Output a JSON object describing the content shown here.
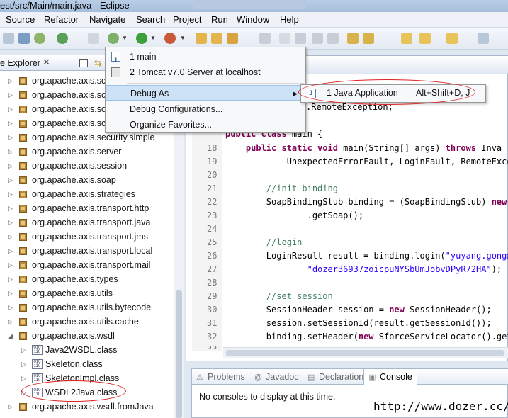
{
  "window": {
    "title": "est/src/Main/main.java - Eclipse"
  },
  "menubar": {
    "items": [
      "Source",
      "Refactor",
      "Navigate",
      "Search",
      "Project",
      "Run",
      "Window",
      "Help"
    ]
  },
  "package_explorer": {
    "title": "e Explorer",
    "close_glyph": "✕",
    "packages": [
      "org.apache.axis.sc",
      "org.apache.axis.sc",
      "org.apache.axis.sc",
      "org.apache.axis.sc",
      "org.apache.axis.security.simple",
      "org.apache.axis.server",
      "org.apache.axis.session",
      "org.apache.axis.soap",
      "org.apache.axis.strategies",
      "org.apache.axis.transport.http",
      "org.apache.axis.transport.java",
      "org.apache.axis.transport.jms",
      "org.apache.axis.transport.local",
      "org.apache.axis.transport.mail",
      "org.apache.axis.types",
      "org.apache.axis.utils",
      "org.apache.axis.utils.bytecode",
      "org.apache.axis.utils.cache",
      "org.apache.axis.wsdl"
    ],
    "classes": [
      "Java2WSDL.class",
      "Skeleton.class",
      "SkeletonImpl.class",
      "WSDL2Java.class"
    ],
    "last_package": "org.apache.axis.wsdl.fromJava"
  },
  "debug_menu": {
    "items": [
      {
        "label": "1 main",
        "icon": "java-app-icon"
      },
      {
        "label": "2 Tomcat v7.0 Server at localhost",
        "icon": "tomcat-icon"
      },
      {
        "label": "Debug As"
      },
      {
        "label": "Debug Configurations..."
      },
      {
        "label": "Organize Favorites..."
      }
    ],
    "submenu": {
      "label": "1 Java Application",
      "accelerator": "Alt+Shift+D, J"
    }
  },
  "editor": {
    "lines": [
      {
        "num": "",
        "code": ".RemoteException;"
      },
      {
        "num": "",
        "code": "public class main {"
      },
      {
        "num": "18",
        "code": "    public static void main(String[] args) throws Inva"
      },
      {
        "num": "19",
        "code": "            UnexpectedErrorFault, LoginFault, RemoteExcep"
      },
      {
        "num": "20",
        "code": ""
      },
      {
        "num": "21",
        "code": "        //init binding"
      },
      {
        "num": "22",
        "code": "        SoapBindingStub binding = (SoapBindingStub) new S"
      },
      {
        "num": "23",
        "code": "                .getSoap();"
      },
      {
        "num": "24",
        "code": ""
      },
      {
        "num": "25",
        "code": "        //login"
      },
      {
        "num": "26",
        "code": "        LoginResult result = binding.login(\"yuyang.gong@d"
      },
      {
        "num": "27",
        "code": "                \"dozer36937zoicpuNYSbUmJobvDPyR72HA\");"
      },
      {
        "num": "28",
        "code": ""
      },
      {
        "num": "29",
        "code": "        //set session"
      },
      {
        "num": "30",
        "code": "        SessionHeader session = new SessionHeader();"
      },
      {
        "num": "31",
        "code": "        session.setSessionId(result.getSessionId());"
      },
      {
        "num": "32",
        "code": "        binding.setHeader(new SforceServiceLocator().getS"
      },
      {
        "num": "33",
        "code": "                "
      }
    ]
  },
  "bottom_panel": {
    "tabs": [
      "Problems",
      "Javadoc",
      "Declaration",
      "Console"
    ],
    "active_tab": "Console",
    "message": "No consoles to display at this time."
  },
  "watermark": "http://www.dozer.cc/",
  "colors": {
    "keyword": "#7f0055",
    "comment": "#3f7f5f",
    "string": "#2a00ff",
    "highlight": "#cde2f7",
    "annotation": "#dd2222"
  }
}
